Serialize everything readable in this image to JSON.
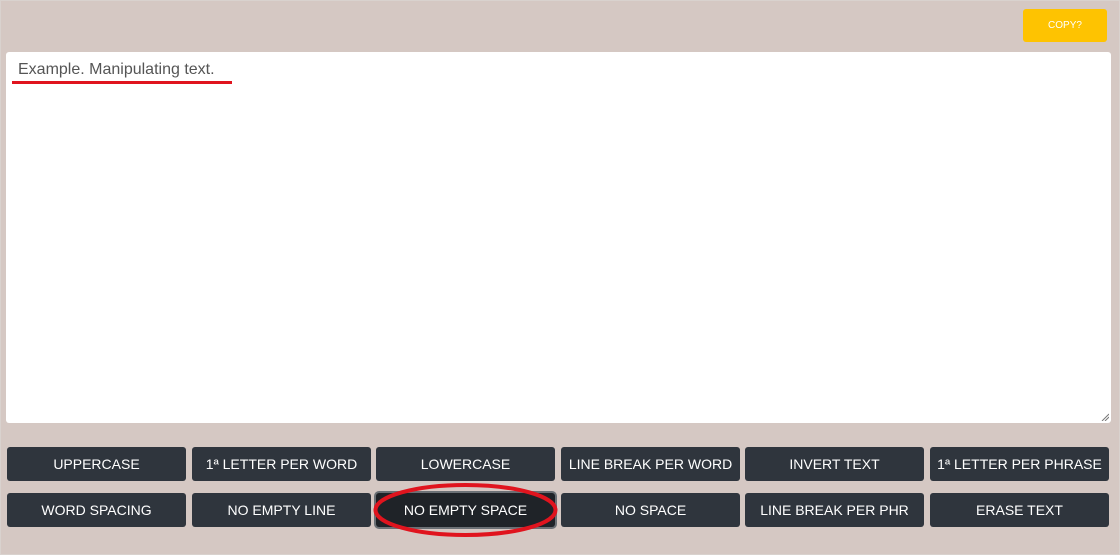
{
  "toolbar": {
    "copy_label": "COPY?"
  },
  "editor": {
    "text": "Example. Manipulating text."
  },
  "buttons": {
    "row1": [
      "UPPERCASE",
      "1ª LETTER PER WORD",
      "LOWERCASE",
      "LINE BREAK PER WORD",
      "INVERT TEXT",
      "1ª LETTER PER PHRASE"
    ],
    "row2": [
      "WORD SPACING",
      "NO EMPTY LINE",
      "NO EMPTY SPACE",
      "NO SPACE",
      "LINE BREAK PER PHR",
      "ERASE TEXT"
    ]
  },
  "colors": {
    "accent": "#fec301",
    "button_bg": "#2f353d",
    "background": "#d5c8c3",
    "annotation": "#e0141e"
  }
}
